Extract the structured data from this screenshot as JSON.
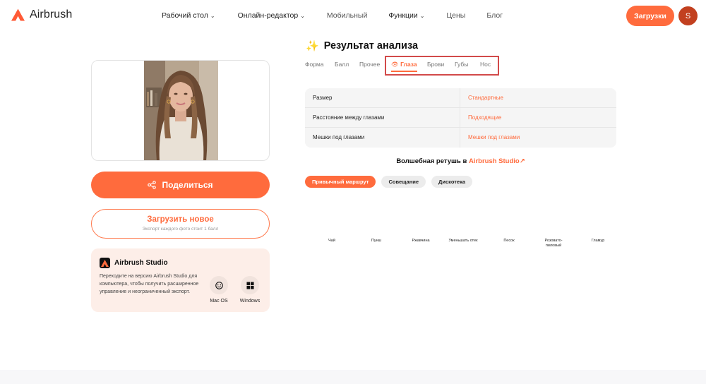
{
  "colors": {
    "accent": "#ff6b3d",
    "highlight": "#d24a4a",
    "avatar": "#c2401f"
  },
  "header": {
    "logo_text": "Airbrush",
    "nav": [
      {
        "label": "Рабочий стол",
        "dropdown": true
      },
      {
        "label": "Онлайн-редактор",
        "dropdown": true
      },
      {
        "label": "Мобильный",
        "dropdown": false
      },
      {
        "label": "Функции",
        "dropdown": true
      },
      {
        "label": "Цены",
        "dropdown": false
      },
      {
        "label": "Блог",
        "dropdown": false
      }
    ],
    "upload_label": "Загрузки",
    "avatar_letter": "S"
  },
  "left": {
    "share_label": "Поделиться",
    "upload_new_label": "Загрузить новое",
    "upload_new_note": "Экспорт каждого фото стоит 1 балл",
    "studio": {
      "title": "Airbrush Studio",
      "desc": "Переходите на версию Airbrush Studio для компьютера, чтобы получить расширенное управление и неограниченный экспорт.",
      "mac_label": "Mac OS",
      "windows_label": "Windows"
    }
  },
  "analysis": {
    "title": "Результат анализа",
    "tabs": [
      "Форма",
      "Балл",
      "Прочее",
      "Глаза",
      "Брови",
      "Губы",
      "Нос"
    ],
    "active_tab": "Глаза",
    "rows": [
      {
        "name": "Размер",
        "value": "Стандартные"
      },
      {
        "name": "Расстояние между глазами",
        "value": "Подходящие"
      },
      {
        "name": "Мешки под глазами",
        "value": "Мешки под глазами"
      }
    ]
  },
  "magic": {
    "text": "Волшебная ретушь в ",
    "link": "Airbrush Studio↗",
    "chips": [
      "Привычный маршрут",
      "Совещание",
      "Дискотека"
    ],
    "active_chip": "Привычный маршрут",
    "looks": [
      "Чай",
      "Пунш",
      "Ржавчина",
      "Уменьшать отек",
      "Песок",
      "Розовато-пиловый",
      "Гламур"
    ]
  }
}
